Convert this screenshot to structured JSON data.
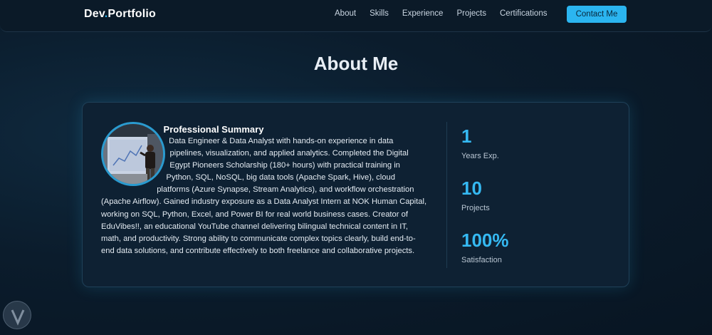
{
  "nav": {
    "brand_main": "Dev",
    "brand_dot": ".",
    "brand_suffix": "Portfolio",
    "links": [
      "About",
      "Skills",
      "Experience",
      "Projects",
      "Certifications"
    ],
    "cta": "Contact Me"
  },
  "about": {
    "title": "About Me",
    "summary_title": "Professional Summary",
    "summary_text": "Data Engineer & Data Analyst with hands-on experience in data pipelines, visualization, and applied analytics. Completed the Digital Egypt Pioneers Scholarship (180+ hours) with practical training in Python, SQL, NoSQL, big data tools (Apache Spark, Hive), cloud platforms (Azure Synapse, Stream Analytics), and workflow orchestration (Apache Airflow). Gained industry exposure as a Data Analyst Intern at NOK Human Capital, working on SQL, Python, Excel, and Power BI for real world business cases. Creator of EduVibes!!, an educational YouTube channel delivering bilingual technical content in IT, math, and productivity. Strong ability to communicate complex topics clearly, build end-to-end data solutions, and contribute effectively to both freelance and collaborative projects.",
    "stats": [
      {
        "value": "1",
        "label": "Years Exp."
      },
      {
        "value": "10",
        "label": "Projects"
      },
      {
        "value": "100%",
        "label": "Satisfaction"
      }
    ]
  },
  "colors": {
    "accent": "#2bb5f0",
    "background": "#0b1c2c",
    "card": "#0e2133"
  }
}
